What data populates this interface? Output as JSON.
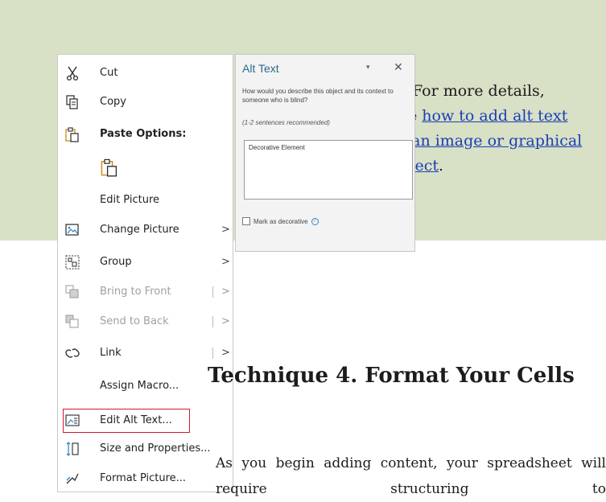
{
  "details": {
    "line1": "For more details,",
    "see_prefix": "see",
    "link_text": "how to add alt text to an image or graphical object",
    "suffix": "."
  },
  "alt_pane": {
    "title": "Alt Text",
    "question": "How would you describe this object and its context to someone who is blind?",
    "hint": "(1-2 sentences recommended)",
    "textbox_value": "Decorative Element",
    "checkbox_label": "Mark as decorative"
  },
  "menu": {
    "items": [
      {
        "label": "Cut",
        "icon": "scissors-icon"
      },
      {
        "label": "Copy",
        "icon": "copy-icon"
      },
      {
        "label": "Paste Options:",
        "icon": "paste-icon"
      },
      {
        "label": "",
        "icon": "paste-picture-icon"
      },
      {
        "label": "Edit Picture",
        "icon": ""
      },
      {
        "label": "Change Picture",
        "icon": "change-picture-icon",
        "submenu": true
      },
      {
        "label": "Group",
        "icon": "group-icon",
        "submenu": true
      },
      {
        "label": "Bring to Front",
        "icon": "bring-to-front-icon",
        "submenu": true,
        "disabled": true
      },
      {
        "label": "Send to Back",
        "icon": "send-to-back-icon",
        "submenu": true,
        "disabled": true
      },
      {
        "label": "Link",
        "icon": "link-icon",
        "submenu": true
      },
      {
        "label": "Assign Macro...",
        "icon": ""
      },
      {
        "label": "Edit Alt Text...",
        "icon": "alt-text-icon",
        "highlighted": true
      },
      {
        "label": "Size and Properties...",
        "icon": "size-icon"
      },
      {
        "label": "Format Picture...",
        "icon": "format-picture-icon"
      }
    ]
  },
  "article": {
    "heading": "Technique 4. Format Your Cells",
    "body": "As you begin adding content, your spreadsheet will require structuring to"
  },
  "colors": {
    "band": "#d8e0c6",
    "link": "#1a3fb4",
    "highlight_border": "#d2182b",
    "pane_title": "#2b6a8a"
  }
}
